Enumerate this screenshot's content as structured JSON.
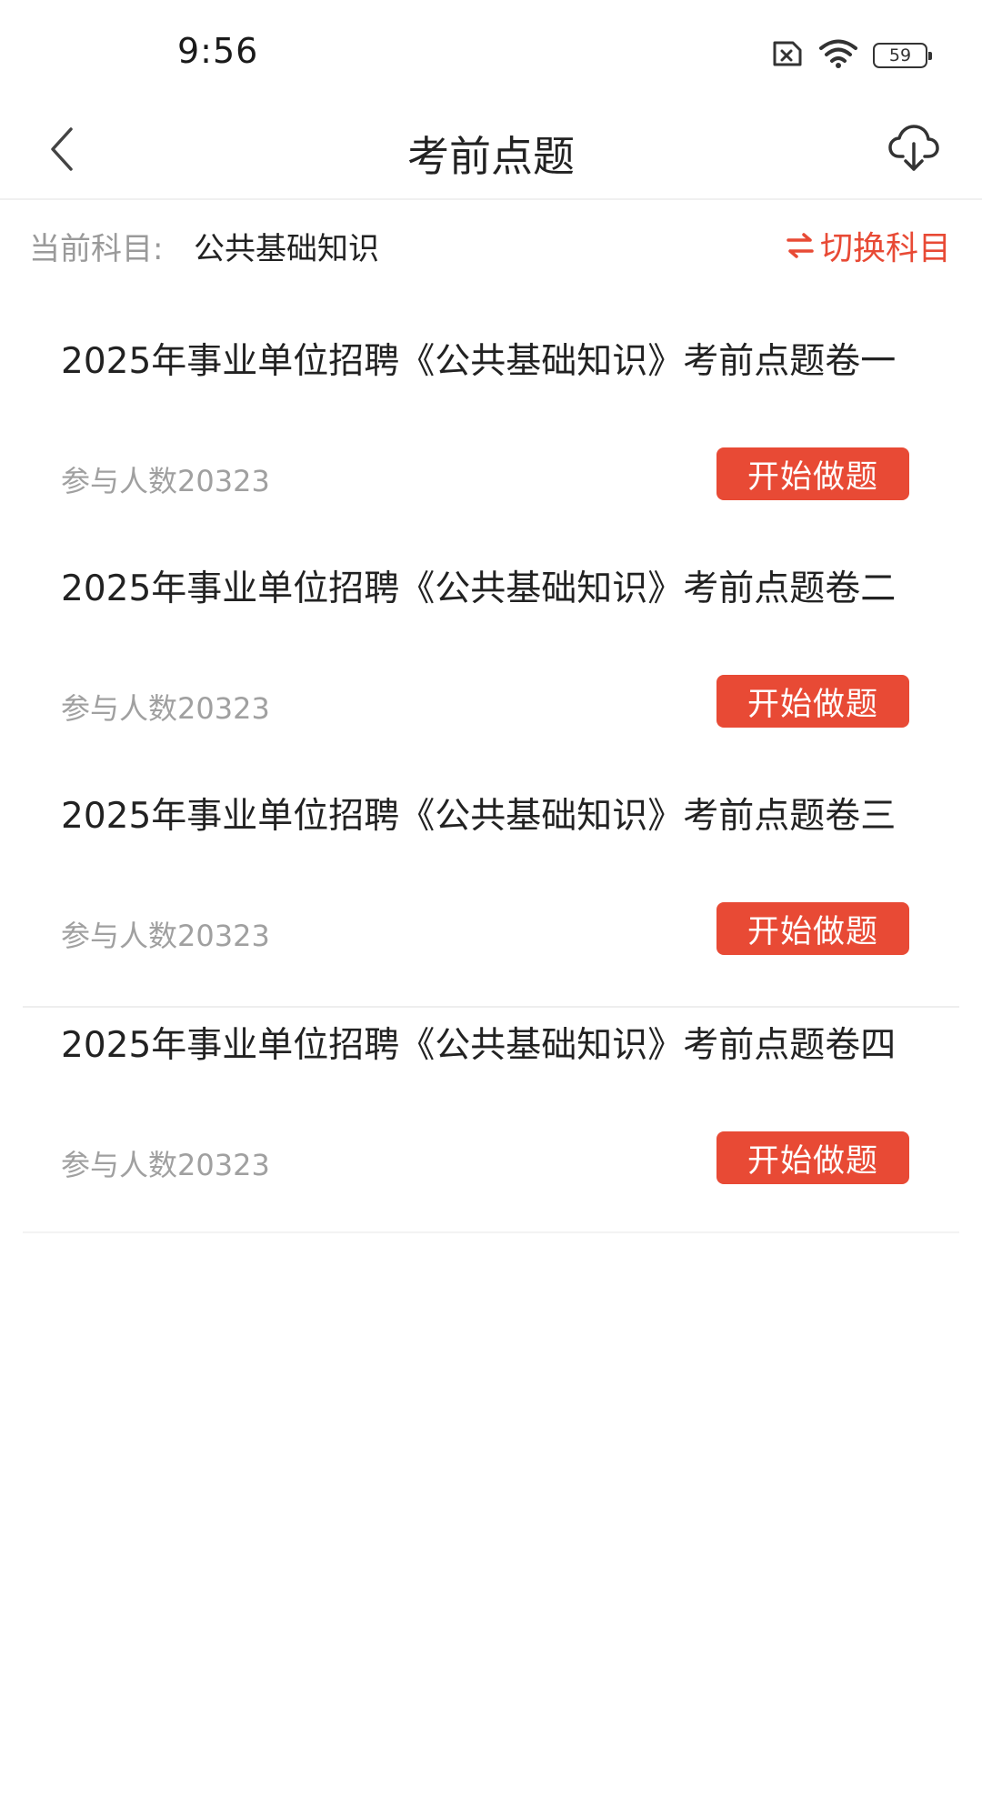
{
  "status_bar": {
    "time": "9:56",
    "battery": "59"
  },
  "nav": {
    "title": "考前点题"
  },
  "subject": {
    "label": "当前科目:",
    "value": "公共基础知识",
    "switch_label": "切换科目"
  },
  "papers": [
    {
      "title": "2025年事业单位招聘《公共基础知识》考前点题卷一",
      "count": "参与人数20323",
      "button": "开始做题"
    },
    {
      "title": "2025年事业单位招聘《公共基础知识》考前点题卷二",
      "count": "参与人数20323",
      "button": "开始做题"
    },
    {
      "title": "2025年事业单位招聘《公共基础知识》考前点题卷三",
      "count": "参与人数20323",
      "button": "开始做题"
    },
    {
      "title": "2025年事业单位招聘《公共基础知识》考前点题卷四",
      "count": "参与人数20323",
      "button": "开始做题"
    }
  ],
  "colors": {
    "accent": "#e84a35",
    "muted_text": "#9a9a9a"
  },
  "icons": {
    "back": "chevron-left-icon",
    "download": "cloud-download-icon",
    "switch": "swap-arrows-icon",
    "sim": "no-sim-icon",
    "wifi": "wifi-icon",
    "battery": "battery-icon"
  }
}
